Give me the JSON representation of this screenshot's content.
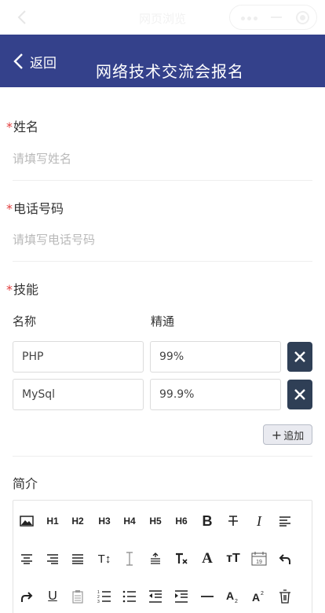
{
  "window": {
    "title": "网页浏览"
  },
  "header": {
    "back_label": "返回",
    "title": "网络技术交流会报名"
  },
  "form": {
    "name": {
      "label": "姓名",
      "required_mark": "*",
      "placeholder": "请填写姓名"
    },
    "phone": {
      "label": "电话号码",
      "required_mark": "*",
      "placeholder": "请填写电话号码"
    },
    "skills": {
      "label": "技能",
      "required_mark": "*",
      "columns": [
        "名称",
        "精通"
      ],
      "rows": [
        {
          "name": "PHP",
          "level": "99%"
        },
        {
          "name": "MySql",
          "level": "99.9%"
        }
      ],
      "add_label": "追加",
      "add_icon": "+"
    },
    "intro": {
      "label": "简介",
      "toolbar_row1": [
        "image-icon",
        "H1",
        "H2",
        "H3",
        "H4",
        "H5",
        "H6",
        "bold-icon",
        "strikethrough-icon",
        "italic-icon",
        "align-left-icon"
      ],
      "toolbar_row2": [
        "align-center-icon",
        "align-right-icon",
        "justify-icon",
        "font-size-icon",
        "line-height-icon",
        "paragraph-spacing-icon",
        "clear-format-icon",
        "font-family-icon",
        "text-size-icon",
        "calendar-icon",
        "undo-icon"
      ],
      "toolbar_row3": [
        "redo-icon",
        "underline-icon",
        "clipboard-icon",
        "ordered-list-icon",
        "bullet-list-icon",
        "outdent-icon",
        "indent-icon",
        "horizontal-rule-icon",
        "subscript-icon",
        "superscript-icon",
        "delete-icon"
      ],
      "calendar_day": "19",
      "text_symbols": {
        "text_size": "T↕",
        "font_family": "A",
        "font_size": "тT",
        "underline": "U",
        "italic": "I",
        "bold": "B"
      }
    }
  },
  "colors": {
    "header_bg": "#34418b",
    "required": "#e23c3c",
    "delete_btn": "#2f3f56",
    "placeholder": "#b9b9b9"
  }
}
